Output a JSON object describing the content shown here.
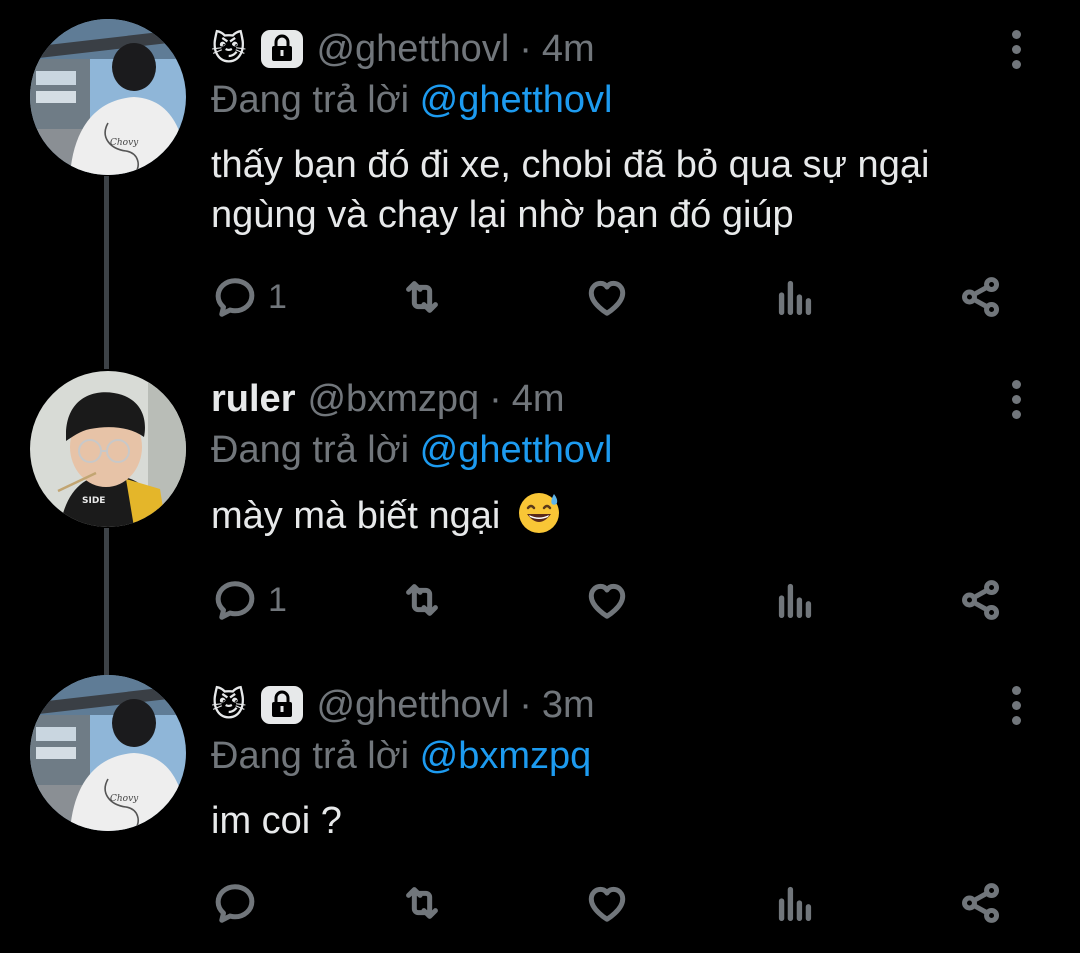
{
  "colors": {
    "background": "#000000",
    "text": "#e7e9ea",
    "secondary": "#71767b",
    "link": "#1d9bf0",
    "thread_line": "#3d4247"
  },
  "reply_prefix": "Đang trả lời",
  "tweets": [
    {
      "author_emoji": "😼",
      "locked": true,
      "display_name": "",
      "handle": "@ghetthovl",
      "separator": "·",
      "time": "4m",
      "reply_to": "@ghetthovl",
      "text_lines": [
        "thấy bạn đó đi xe, chobi đã bỏ qua sự ngại",
        "ngùng và chạy lại nhờ bạn đó giúp"
      ],
      "reply_count": "1",
      "icons": [
        "reply-icon",
        "retweet-icon",
        "like-icon",
        "analytics-icon",
        "share-icon",
        "more-icon"
      ]
    },
    {
      "author_emoji": "",
      "locked": false,
      "display_name": "ruler",
      "handle": "@bxmzpq",
      "separator": "·",
      "time": "4m",
      "reply_to": "@ghetthovl",
      "text_lines": [
        "mày mà biết ngại"
      ],
      "text_emoji": "😅",
      "reply_count": "1",
      "icons": [
        "reply-icon",
        "retweet-icon",
        "like-icon",
        "analytics-icon",
        "share-icon",
        "more-icon"
      ]
    },
    {
      "author_emoji": "😼",
      "locked": true,
      "display_name": "",
      "handle": "@ghetthovl",
      "separator": "·",
      "time": "3m",
      "reply_to": "@bxmzpq",
      "text_lines": [
        "im coi ?"
      ],
      "reply_count": "",
      "icons": [
        "reply-icon",
        "retweet-icon",
        "like-icon",
        "analytics-icon",
        "share-icon",
        "more-icon"
      ]
    }
  ]
}
